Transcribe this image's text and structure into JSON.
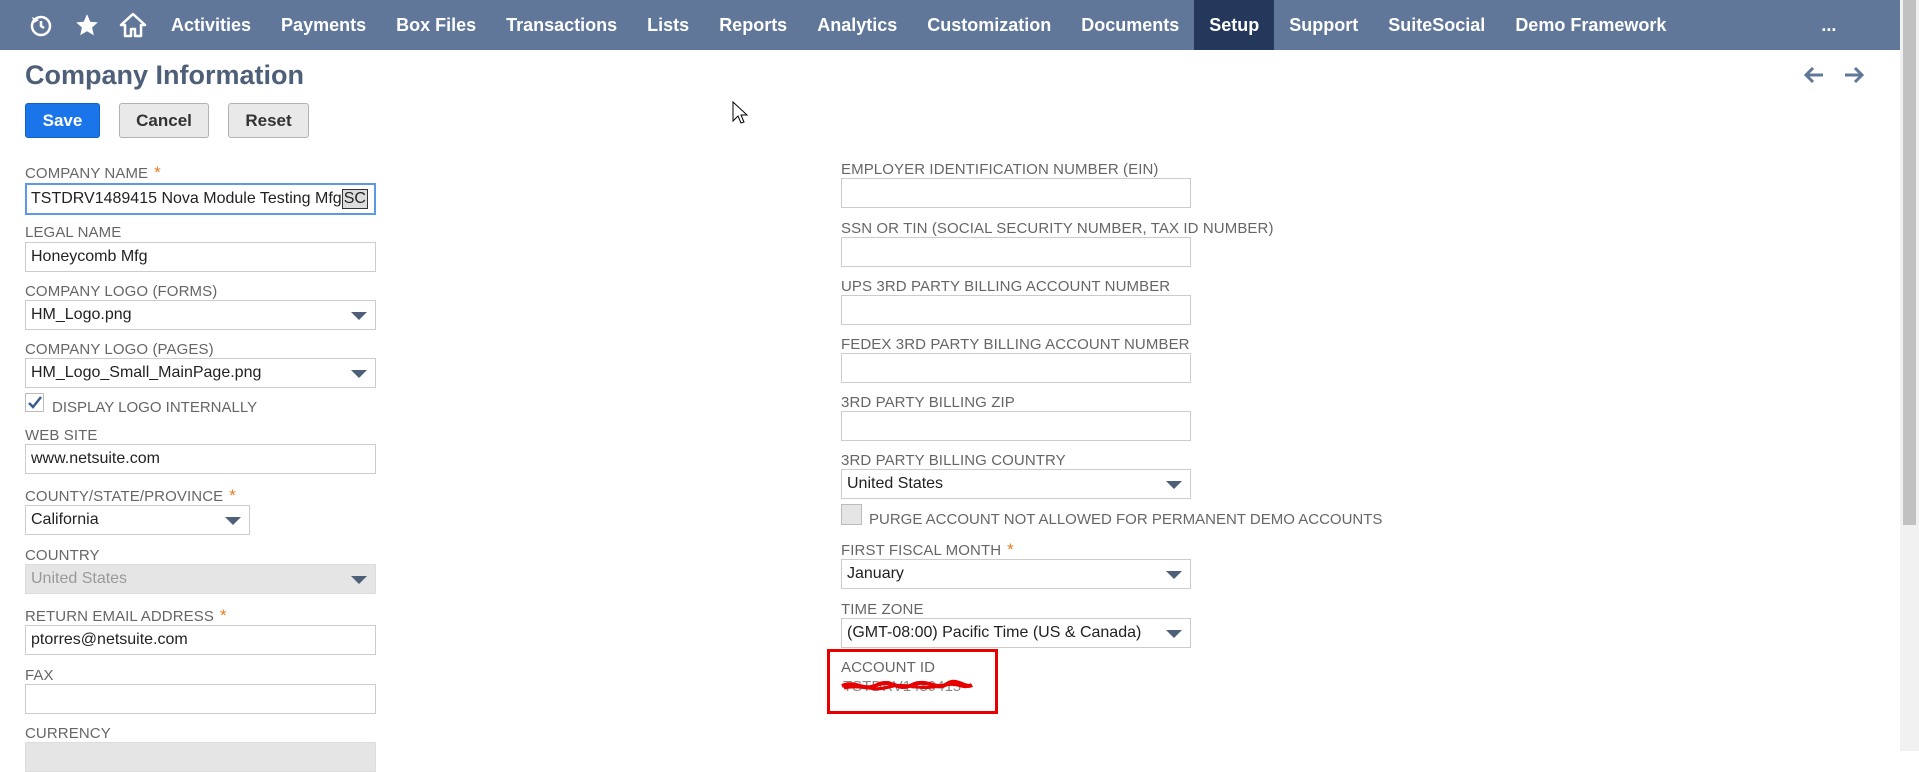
{
  "nav": {
    "icons": [
      "recent-icon",
      "star-icon",
      "home-icon"
    ],
    "items": [
      "Activities",
      "Payments",
      "Box Files",
      "Transactions",
      "Lists",
      "Reports",
      "Analytics",
      "Customization",
      "Documents",
      "Setup",
      "Support",
      "SuiteSocial",
      "Demo Framework"
    ],
    "active": "Setup",
    "more": "..."
  },
  "page": {
    "title": "Company Information",
    "buttons": {
      "save": "Save",
      "cancel": "Cancel",
      "reset": "Reset"
    }
  },
  "left": {
    "company_name": {
      "label": "Company Name",
      "required": "*",
      "value": "TSTDRV1489415 Nova Module Testing Mfg ",
      "value_cursor": "SC"
    },
    "legal_name": {
      "label": "Legal Name",
      "value": "Honeycomb Mfg"
    },
    "logo_forms": {
      "label": "Company Logo (Forms)",
      "value": "HM_Logo.png"
    },
    "logo_pages": {
      "label": "Company Logo (Pages)",
      "value": "HM_Logo_Small_MainPage.png"
    },
    "display_logo": {
      "label": "Display Logo Internally",
      "checked": true
    },
    "web_site": {
      "label": "Web Site",
      "value": "www.netsuite.com"
    },
    "state": {
      "label": "County/State/Province",
      "required": "*",
      "value": "California"
    },
    "country": {
      "label": "Country",
      "value": "United States"
    },
    "return_email": {
      "label": "Return Email Address",
      "required": "*",
      "value": "ptorres@netsuite.com"
    },
    "fax": {
      "label": "Fax",
      "value": ""
    },
    "currency": {
      "label": "Currency"
    }
  },
  "right": {
    "ein": {
      "label": "Employer Identification Number (EIN)",
      "value": ""
    },
    "ssn": {
      "label": "SSN or TIN (Social Security Number, Tax ID Number)",
      "value": ""
    },
    "ups": {
      "label": "UPS 3rd Party Billing Account Number",
      "value": ""
    },
    "fedex": {
      "label": "FedEx 3rd Party Billing Account Number",
      "value": ""
    },
    "zip": {
      "label": "3rd Party Billing Zip",
      "value": ""
    },
    "billing_country": {
      "label": "3rd Party Billing Country",
      "value": "United States"
    },
    "purge": {
      "label": "Purge Account Not Allowed for Permanent Demo Accounts",
      "checked": false
    },
    "fiscal_month": {
      "label": "First Fiscal Month",
      "required": "*",
      "value": "January"
    },
    "time_zone": {
      "label": "Time Zone",
      "value": "(GMT-08:00) Pacific Time (US & Canada)"
    },
    "account_id": {
      "label": "Account ID",
      "value": "TSTDRV1489415"
    }
  },
  "colors": {
    "nav_bg": "#607799",
    "nav_active": "#24385b",
    "save_btn": "#1a75ea",
    "title": "#4d5f79",
    "highlight": "#e60000"
  }
}
